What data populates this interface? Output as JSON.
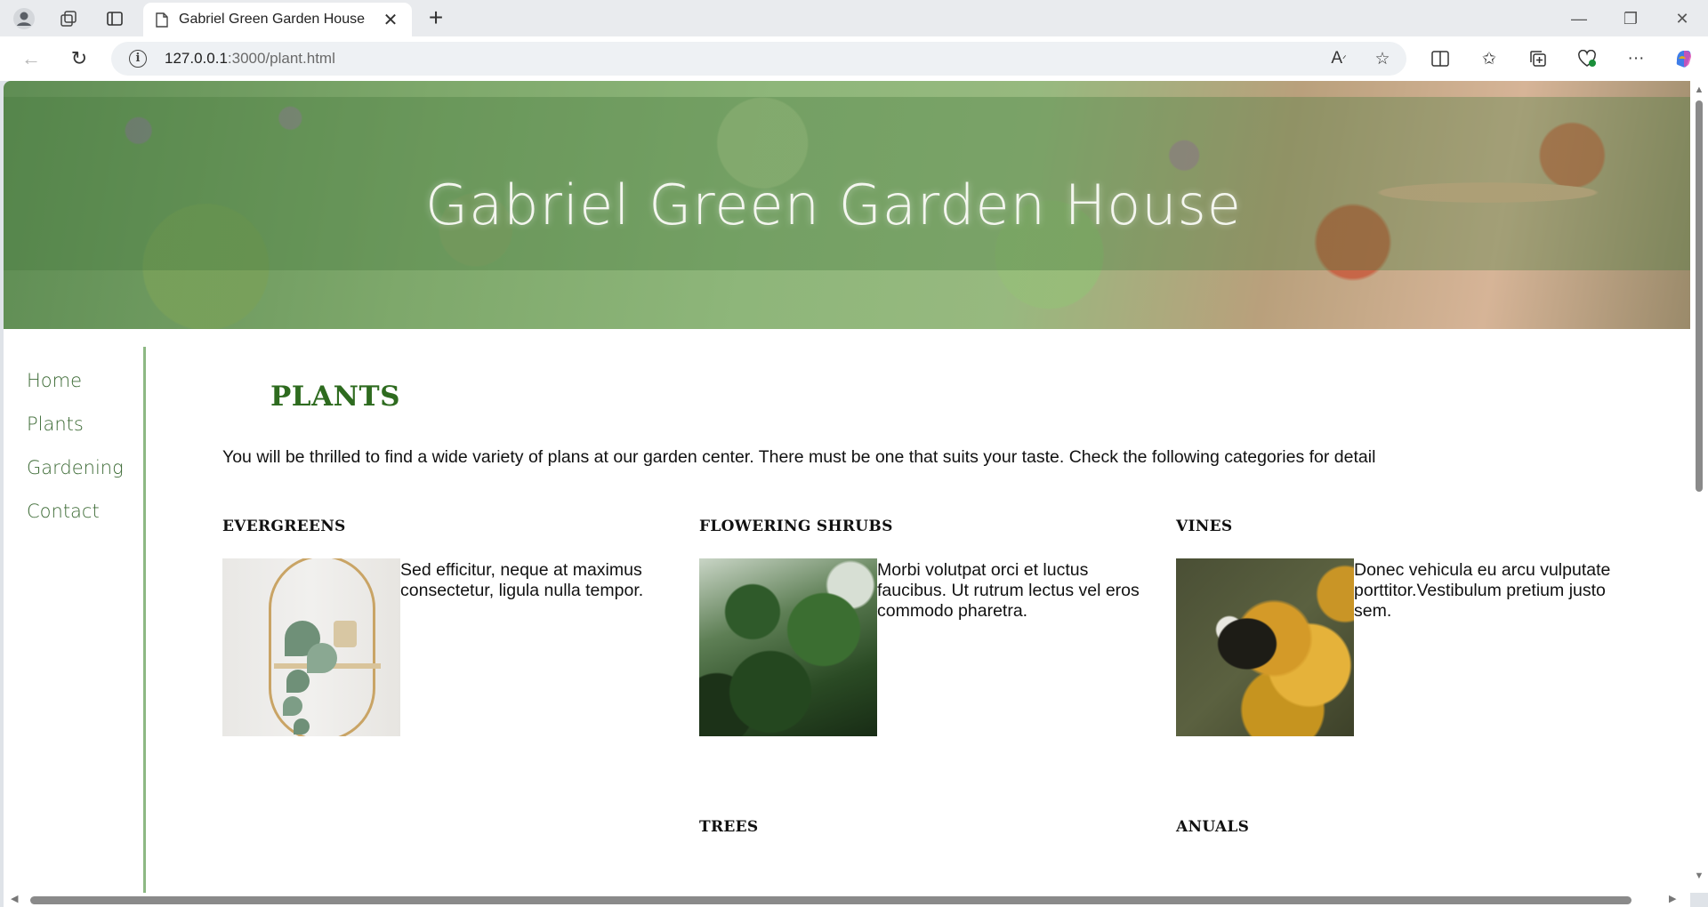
{
  "browser": {
    "tab_title": "Gabriel Green Garden House",
    "url_host": "127.0.0.1",
    "url_rest": ":3000/plant.html"
  },
  "site": {
    "title": "Gabriel Green Garden House",
    "nav": [
      "Home",
      "Plants",
      "Gardening",
      "Contact"
    ],
    "page_heading": "PLANTS",
    "intro": "You will be thrilled to find a wide variety of plans at our garden center. There must be one that suits your taste. Check the following categories for detail",
    "categories": [
      {
        "name": "EVERGREENS",
        "text": "Sed efficitur, neque at maximus consectetur, ligula nulla tempor."
      },
      {
        "name": "FLOWERING SHRUBS",
        "text": "Morbi volutpat orci et luctus faucibus. Ut rutrum lectus vel eros commodo pharetra."
      },
      {
        "name": "VINES",
        "text": "Donec vehicula eu arcu vulputate porttitor.Vestibulum pretium justo sem."
      },
      {
        "name": "TREES"
      },
      {
        "name": "ANUALS"
      }
    ]
  },
  "colors": {
    "accent_green": "#2e6b1f",
    "nav_green": "#3d6b36",
    "divider": "#8db883"
  }
}
